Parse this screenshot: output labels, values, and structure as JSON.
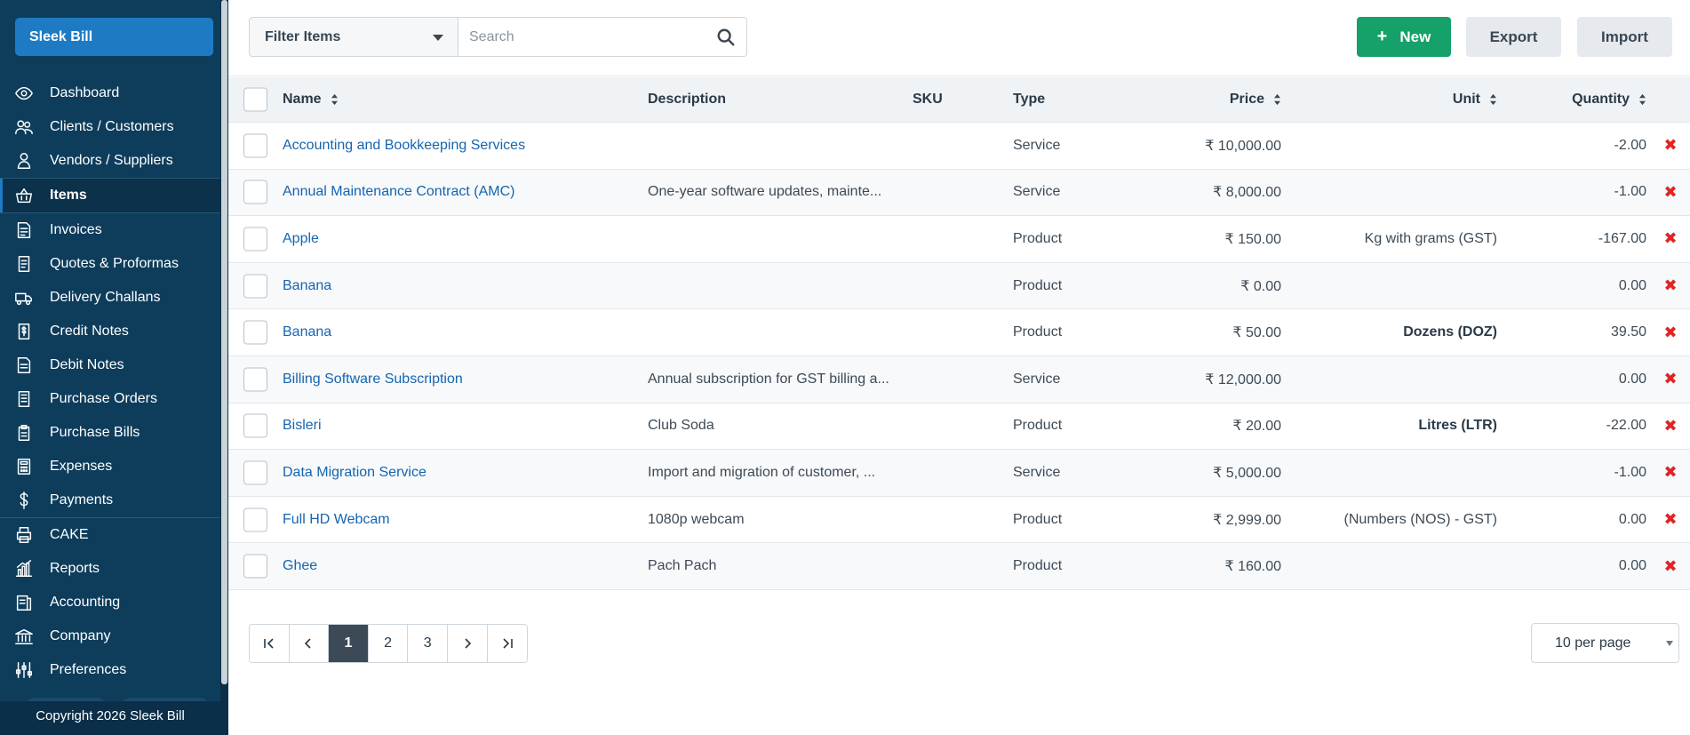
{
  "sidebar": {
    "brand": "Sleek Bill",
    "items": [
      {
        "label": "Dashboard",
        "icon": "eye-icon"
      },
      {
        "label": "Clients / Customers",
        "icon": "users-icon"
      },
      {
        "label": "Vendors / Suppliers",
        "icon": "user-icon"
      },
      {
        "label": "Items",
        "icon": "basket-icon",
        "active": true
      },
      {
        "label": "Invoices",
        "icon": "invoice-icon"
      },
      {
        "label": "Quotes & Proformas",
        "icon": "document-icon"
      },
      {
        "label": "Delivery Challans",
        "icon": "truck-icon"
      },
      {
        "label": "Credit Notes",
        "icon": "dollar-doc-icon"
      },
      {
        "label": "Debit Notes",
        "icon": "doc-lines-icon"
      },
      {
        "label": "Purchase Orders",
        "icon": "order-doc-icon"
      },
      {
        "label": "Purchase Bills",
        "icon": "clipboard-icon"
      },
      {
        "label": "Expenses",
        "icon": "calculator-icon"
      },
      {
        "label": "Payments",
        "icon": "dollar-icon"
      },
      {
        "label": "CAKE",
        "icon": "printer-icon"
      },
      {
        "label": "Reports",
        "icon": "chart-icon"
      },
      {
        "label": "Accounting",
        "icon": "ledger-icon"
      },
      {
        "label": "Company",
        "icon": "bank-icon"
      },
      {
        "label": "Preferences",
        "icon": "sliders-icon"
      }
    ],
    "footer": "Copyright 2026 Sleek Bill"
  },
  "toolbar": {
    "filter_label": "Filter Items",
    "search_placeholder": "Search",
    "new_label": "New",
    "export_label": "Export",
    "import_label": "Import"
  },
  "table": {
    "headers": {
      "name": "Name",
      "description": "Description",
      "sku": "SKU",
      "type": "Type",
      "price": "Price",
      "unit": "Unit",
      "quantity": "Quantity"
    },
    "rows": [
      {
        "name": "Accounting and Bookkeeping Services",
        "description": "",
        "sku": "",
        "type": "Service",
        "price": "₹ 10,000.00",
        "unit": "",
        "unit_bold": false,
        "quantity": "-2.00"
      },
      {
        "name": "Annual Maintenance Contract (AMC)",
        "description": "One-year software updates, mainte...",
        "sku": "",
        "type": "Service",
        "price": "₹ 8,000.00",
        "unit": "",
        "unit_bold": false,
        "quantity": "-1.00"
      },
      {
        "name": "Apple",
        "description": "",
        "sku": "",
        "type": "Product",
        "price": "₹ 150.00",
        "unit": "Kg with grams (GST)",
        "unit_bold": false,
        "quantity": "-167.00"
      },
      {
        "name": "Banana",
        "description": "",
        "sku": "",
        "type": "Product",
        "price": "₹ 0.00",
        "unit": "",
        "unit_bold": false,
        "quantity": "0.00"
      },
      {
        "name": "Banana",
        "description": "",
        "sku": "",
        "type": "Product",
        "price": "₹ 50.00",
        "unit": "Dozens (DOZ)",
        "unit_bold": true,
        "quantity": "39.50"
      },
      {
        "name": "Billing Software Subscription",
        "description": "Annual subscription for GST billing a...",
        "sku": "",
        "type": "Service",
        "price": "₹ 12,000.00",
        "unit": "",
        "unit_bold": false,
        "quantity": "0.00"
      },
      {
        "name": "Bisleri",
        "description": "Club Soda",
        "sku": "",
        "type": "Product",
        "price": "₹ 20.00",
        "unit": "Litres (LTR)",
        "unit_bold": true,
        "quantity": "-22.00"
      },
      {
        "name": "Data Migration Service",
        "description": "Import and migration of customer, ...",
        "sku": "",
        "type": "Service",
        "price": "₹ 5,000.00",
        "unit": "",
        "unit_bold": false,
        "quantity": "-1.00"
      },
      {
        "name": "Full HD Webcam",
        "description": "1080p webcam",
        "sku": "",
        "type": "Product",
        "price": "₹ 2,999.00",
        "unit": "(Numbers (NOS) - GST)",
        "unit_bold": false,
        "quantity": "0.00"
      },
      {
        "name": "Ghee",
        "description": "Pach Pach",
        "sku": "",
        "type": "Product",
        "price": "₹ 160.00",
        "unit": "",
        "unit_bold": false,
        "quantity": "0.00"
      }
    ],
    "delete_glyph": "✖"
  },
  "pagination": {
    "pages": [
      "1",
      "2",
      "3"
    ],
    "current": "1",
    "per_page": "10 per page"
  },
  "colors": {
    "sidebar_bg": "#0e3d5c",
    "brand_button": "#1e7bc3",
    "new_button": "#16a06a",
    "link": "#1565b0",
    "delete": "#e02424"
  }
}
